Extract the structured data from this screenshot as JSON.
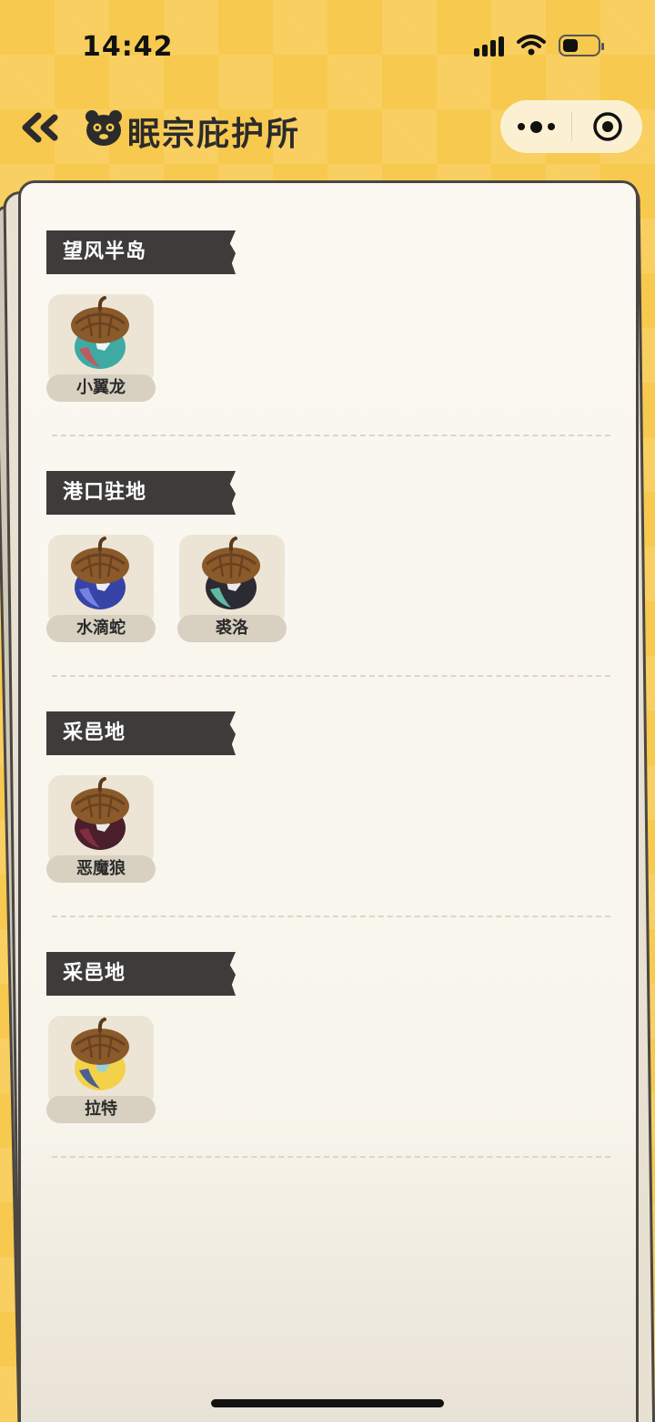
{
  "status_bar": {
    "time": "14:42",
    "battery_level": 0.45
  },
  "nav": {
    "title": "眠宗庇护所"
  },
  "sections": [
    {
      "region": "望风半岛",
      "pets": [
        {
          "name": "小翼龙",
          "colors": {
            "body": "#3fa9a3",
            "accent": "#d24d57",
            "spot": "#ffffff"
          }
        }
      ]
    },
    {
      "region": "港口驻地",
      "pets": [
        {
          "name": "水滴蛇",
          "colors": {
            "body": "#3644a8",
            "accent": "#7f8ee6",
            "spot": "#ffffff"
          }
        },
        {
          "name": "裘洛",
          "colors": {
            "body": "#2c2a33",
            "accent": "#6ad3b6",
            "spot": "#ffffff"
          }
        }
      ]
    },
    {
      "region": "采邑地",
      "pets": [
        {
          "name": "恶魔狼",
          "colors": {
            "body": "#4a1e2a",
            "accent": "#8b2f45",
            "spot": "#ffffff"
          }
        }
      ]
    },
    {
      "region": "采邑地",
      "pets": [
        {
          "name": "拉特",
          "colors": {
            "body": "#f3d24a",
            "accent": "#2e4c9c",
            "spot": "#8ad3f0"
          }
        }
      ]
    }
  ],
  "icons": {
    "back": "double-chevron-left-icon",
    "logo": "bear-face-icon",
    "more": "more-dots-icon",
    "close": "target-circle-icon"
  }
}
